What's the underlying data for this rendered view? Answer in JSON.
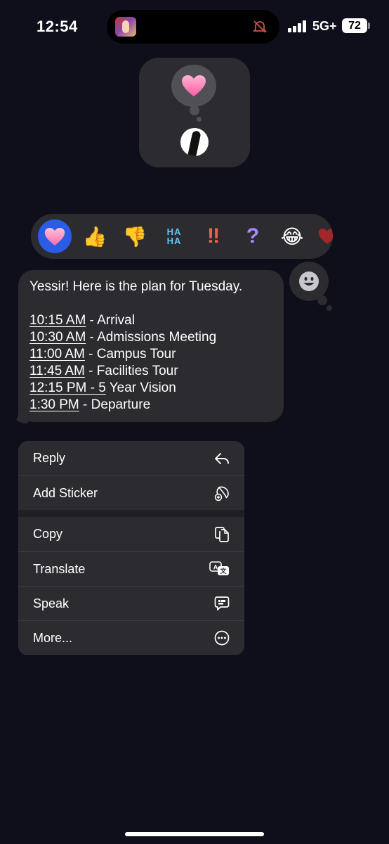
{
  "status_bar": {
    "time": "12:54",
    "network": "5G+",
    "battery": "72"
  },
  "icons": {
    "island_thumbnail": "thumbnail-image",
    "island_muted": "muted-bell-icon",
    "signal": "signal-bars-icon",
    "contact_heart": "pink-heart-icon",
    "emoji_picker": "smiley-icon"
  },
  "tapbacks": [
    {
      "name": "heart",
      "glyph": "🩷",
      "selected": true
    },
    {
      "name": "thumbs-up",
      "glyph": "👍",
      "selected": false
    },
    {
      "name": "thumbs-down",
      "glyph": "👎",
      "selected": false
    },
    {
      "name": "haha",
      "glyph": "HA HA",
      "selected": false
    },
    {
      "name": "exclamation",
      "glyph": "‼",
      "selected": false
    },
    {
      "name": "question",
      "glyph": "?",
      "selected": false
    },
    {
      "name": "laughing",
      "glyph": "😂",
      "selected": false
    }
  ],
  "message": {
    "intro": "Yessir! Here is the plan for Tuesday.",
    "schedule": [
      {
        "time": "10:15 AM",
        "sep": " - ",
        "event": "Arrival"
      },
      {
        "time": "10:30 AM",
        "sep": " - ",
        "event": "Admissions Meeting"
      },
      {
        "time": "11:00 AM",
        "sep": " - ",
        "event": "Campus Tour"
      },
      {
        "time": "11:45 AM",
        "sep": " - ",
        "event": "Facilities Tour"
      },
      {
        "time": "12:15 PM - 5",
        "sep": " ",
        "event": "Year Vision"
      },
      {
        "time": "1:30 PM",
        "sep": " - ",
        "event": "Departure"
      }
    ]
  },
  "menu": {
    "group1": [
      {
        "label": "Reply",
        "icon": "reply-arrow-icon"
      },
      {
        "label": "Add Sticker",
        "icon": "add-sticker-icon"
      }
    ],
    "group2": [
      {
        "label": "Copy",
        "icon": "copy-icon"
      },
      {
        "label": "Translate",
        "icon": "translate-icon"
      },
      {
        "label": "Speak",
        "icon": "speak-bubble-icon"
      },
      {
        "label": "More...",
        "icon": "more-ellipsis-icon"
      }
    ]
  },
  "colors": {
    "background": "#0e0f1a",
    "surface": "#2c2c30",
    "selected_tapback": "#2b5ce6",
    "heart": "#ff7eb6"
  }
}
